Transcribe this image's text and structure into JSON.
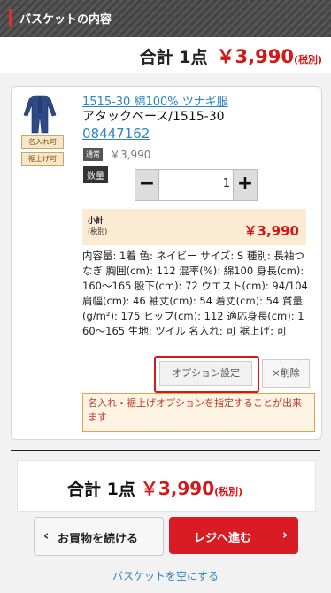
{
  "header": {
    "title": "バスケットの内容"
  },
  "summary_top": {
    "label": "合計 1点",
    "price": "￥3,990",
    "tax": "(税別)"
  },
  "item": {
    "badges": [
      "名入れ可",
      "裾上げ可"
    ],
    "name": "1515-30 綿100% ツナギ服",
    "subtitle": "アタックベース/1515-30",
    "code": "08447162",
    "price_tag": "通常",
    "price": "￥3,990",
    "qty_label": "数量",
    "qty_value": "1",
    "minus": "−",
    "plus": "+",
    "subtotal_label": "小計",
    "subtotal_tax": "(税別)",
    "subtotal_price": "￥3,990",
    "details": "内容量: 1着 色: ネイビー サイズ: S 種別: 長袖つなぎ 胸囲(cm): 112 混率(%): 綿100 身長(cm): 160～165 股下(cm): 72 ウエスト(cm): 94/104 肩幅(cm): 46 袖丈(cm): 54 着丈(cm): 54 質量(g/m²): 175 ヒップ(cm): 112 適応身長(cm): 160～165 生地: ツイル 名入れ: 可 裾上げ: 可",
    "option_button": "オプション設定",
    "delete_button": "×削除",
    "note": "名入れ・裾上げオプションを指定することが出来ます"
  },
  "summary_bottom": {
    "label": "合計 1点",
    "price": "￥3,990",
    "tax": "(税別)"
  },
  "buttons": {
    "continue": "お買物を続ける",
    "checkout": "レジへ進む",
    "empty": "バスケットを空にする"
  },
  "colors": {
    "accent_red": "#d41717",
    "link_blue": "#2a86c8",
    "header_bg": "#4a4a4a"
  },
  "icons": {
    "continue": "chevron-left-icon",
    "checkout": "chevron-right-icon"
  }
}
